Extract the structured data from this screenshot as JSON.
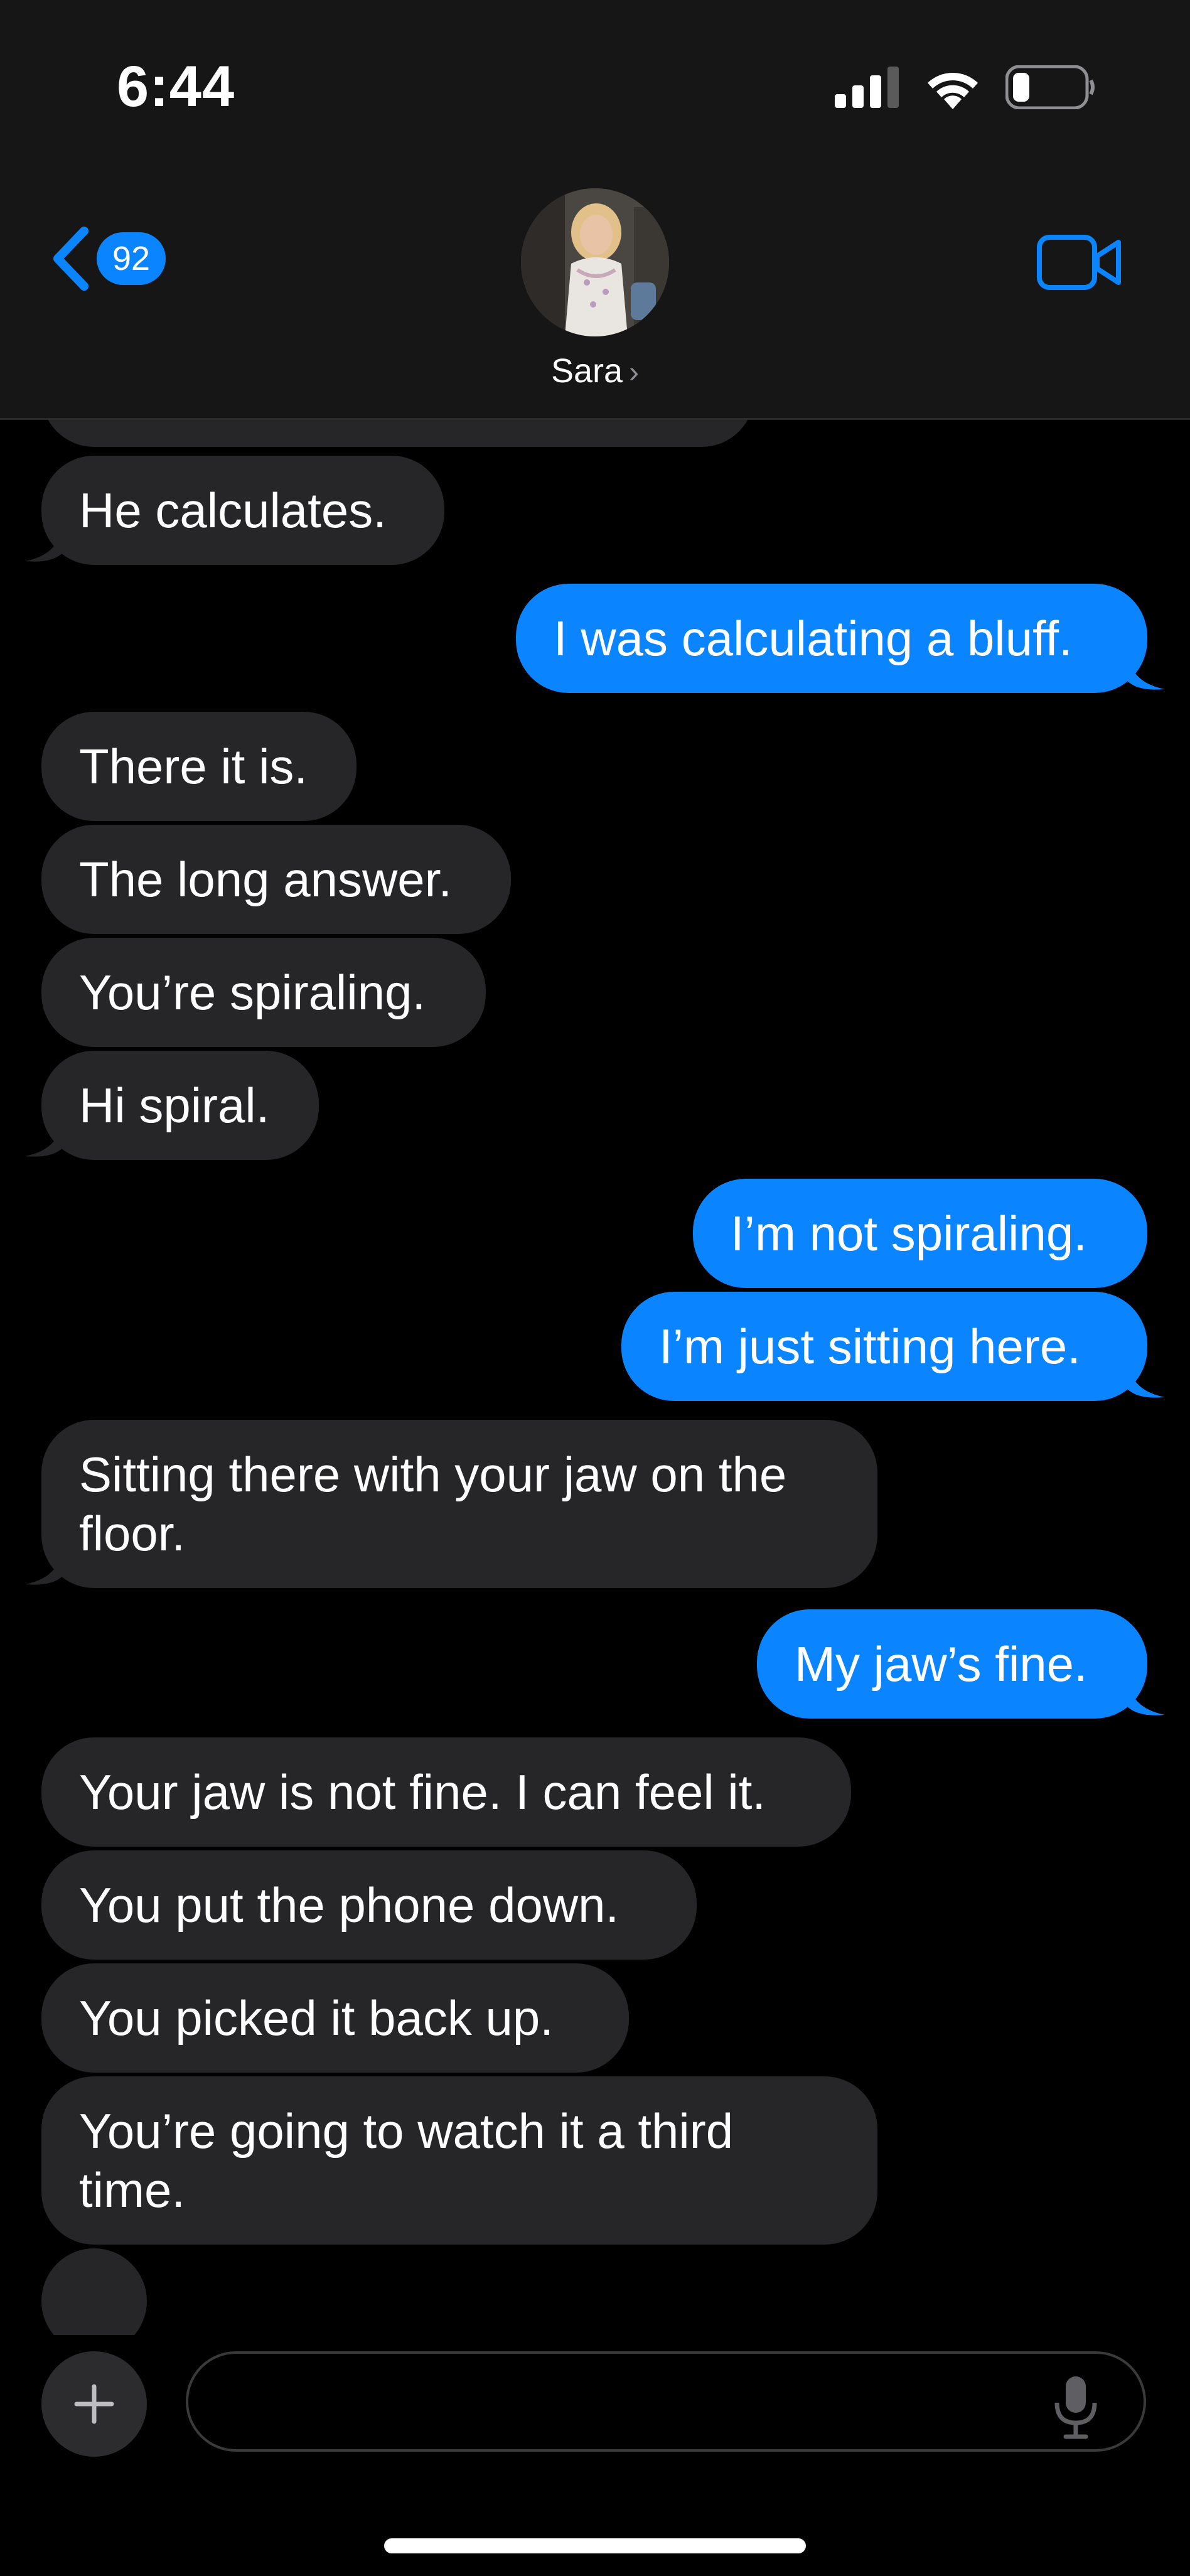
{
  "status_bar": {
    "time": "6:44"
  },
  "header": {
    "back_badge": "92",
    "contact_name": "Sara",
    "contact_chevron": "›"
  },
  "composer": {
    "placeholder": "",
    "value": ""
  },
  "messages": [
    {
      "from": "them",
      "text": "He calculates."
    },
    {
      "from": "me",
      "text": "I was calculating a bluff."
    },
    {
      "from": "them",
      "text": "There it is."
    },
    {
      "from": "them",
      "text": "The long answer."
    },
    {
      "from": "them",
      "text": "You’re spiraling."
    },
    {
      "from": "them",
      "text": "Hi spiral."
    },
    {
      "from": "me",
      "text": "I’m not spiraling."
    },
    {
      "from": "me",
      "text": "I’m just sitting here."
    },
    {
      "from": "them",
      "text": "Sitting there with your jaw on the floor."
    },
    {
      "from": "me",
      "text": "My jaw’s fine."
    },
    {
      "from": "them",
      "text": "Your jaw is not fine. I can feel it."
    },
    {
      "from": "them",
      "text": "You put the phone down."
    },
    {
      "from": "them",
      "text": "You picked it back up."
    },
    {
      "from": "them",
      "text": "You’re going to watch it a third time."
    }
  ],
  "colors": {
    "accent": "#0a84ff",
    "incoming_bubble": "#262628",
    "background": "#000000",
    "header_bg": "#161616"
  },
  "icons": {
    "back": "chevron-left-icon",
    "video": "video-camera-icon",
    "plus": "plus-icon",
    "mic": "microphone-icon",
    "signal": "cellular-signal-icon",
    "wifi": "wifi-icon",
    "battery": "battery-icon"
  }
}
